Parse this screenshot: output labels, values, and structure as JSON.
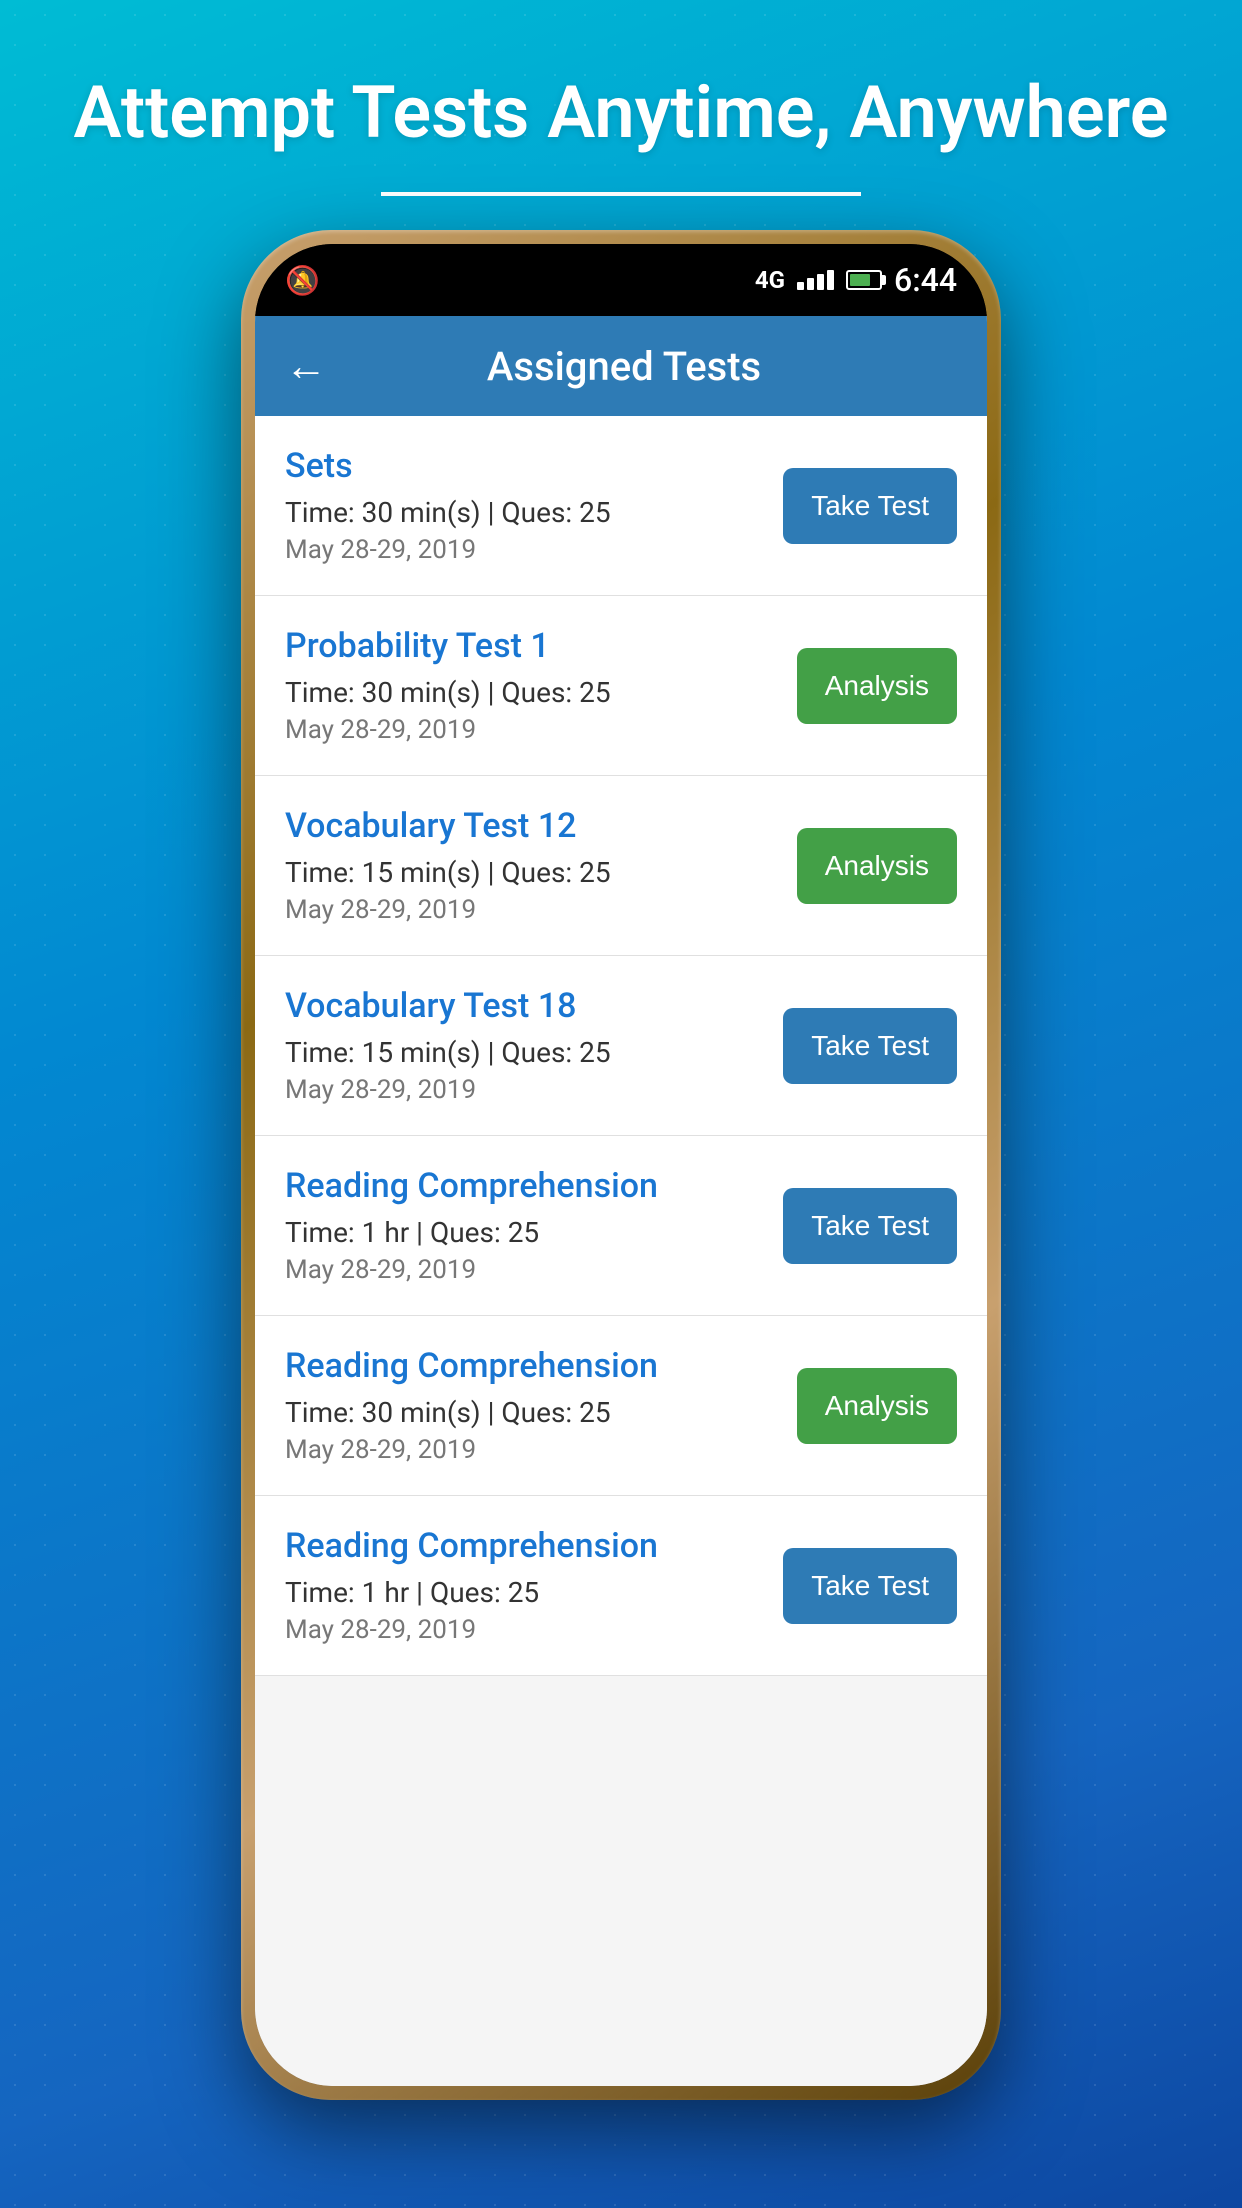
{
  "page": {
    "headline": "Attempt Tests Anytime, Anywhere",
    "headline_part1": "Attempt Tests",
    "headline_part2": "Anytime, Anywhere"
  },
  "status_bar": {
    "time": "6:44",
    "network": "4G"
  },
  "header": {
    "title": "Assigned Tests",
    "back_label": "←"
  },
  "tests": [
    {
      "id": 1,
      "name": "Sets",
      "details": "Time: 30 min(s) | Ques: 25",
      "date": "May 28-29, 2019",
      "button_type": "take_test",
      "button_label": "Take Test"
    },
    {
      "id": 2,
      "name": "Probability Test 1",
      "details": "Time: 30 min(s) | Ques: 25",
      "date": "May 28-29, 2019",
      "button_type": "analysis",
      "button_label": "Analysis"
    },
    {
      "id": 3,
      "name": "Vocabulary Test 12",
      "details": "Time: 15 min(s) | Ques: 25",
      "date": "May 28-29, 2019",
      "button_type": "analysis",
      "button_label": "Analysis"
    },
    {
      "id": 4,
      "name": "Vocabulary Test 18",
      "details": "Time: 15 min(s) | Ques: 25",
      "date": "May 28-29, 2019",
      "button_type": "take_test",
      "button_label": "Take Test"
    },
    {
      "id": 5,
      "name": "Reading Comprehension",
      "details": "Time: 1 hr | Ques: 25",
      "date": "May 28-29, 2019",
      "button_type": "take_test",
      "button_label": "Take Test"
    },
    {
      "id": 6,
      "name": "Reading Comprehension",
      "details": "Time: 30 min(s) | Ques: 25",
      "date": "May 28-29, 2019",
      "button_type": "analysis",
      "button_label": "Analysis"
    },
    {
      "id": 7,
      "name": "Reading Comprehension",
      "details": "Time: 1 hr | Ques: 25",
      "date": "May 28-29, 2019",
      "button_type": "take_test",
      "button_label": "Take Test"
    }
  ]
}
